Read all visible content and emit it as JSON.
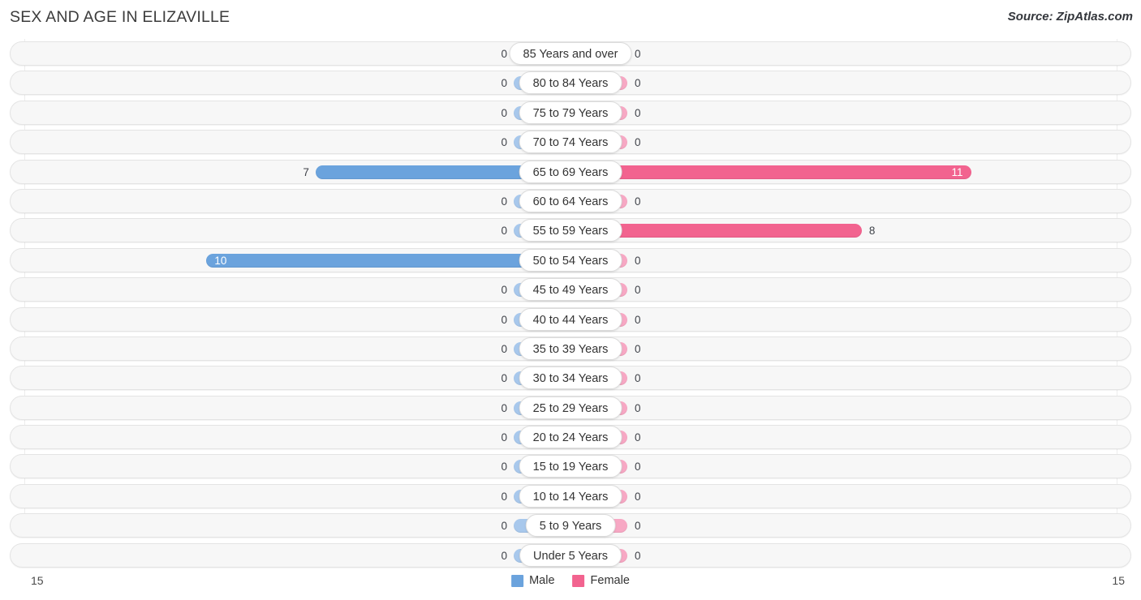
{
  "header": {
    "title": "SEX AND AGE IN ELIZAVILLE",
    "source": "Source: ZipAtlas.com"
  },
  "legend": {
    "male_label": "Male",
    "female_label": "Female",
    "male_color": "#6ba3dd",
    "female_color": "#f2638f"
  },
  "axis": {
    "left_max": "15",
    "right_max": "15"
  },
  "colors": {
    "male_active": "#6ba3dd",
    "male_zero": "#a8c8ec",
    "female_active": "#f2638f",
    "female_zero": "#f7a8c4",
    "track": "#f7f7f7",
    "track_border": "#e4e4e4"
  },
  "chart_data": {
    "type": "bar",
    "subtype": "population-pyramid",
    "title": "SEX AND AGE IN ELIZAVILLE",
    "source": "Source: ZipAtlas.com",
    "xlabel": "",
    "ylabel": "",
    "xlim": [
      15,
      15
    ],
    "grid": true,
    "legend_position": "bottom-center",
    "categories": [
      "85 Years and over",
      "80 to 84 Years",
      "75 to 79 Years",
      "70 to 74 Years",
      "65 to 69 Years",
      "60 to 64 Years",
      "55 to 59 Years",
      "50 to 54 Years",
      "45 to 49 Years",
      "40 to 44 Years",
      "35 to 39 Years",
      "30 to 34 Years",
      "25 to 29 Years",
      "20 to 24 Years",
      "15 to 19 Years",
      "10 to 14 Years",
      "5 to 9 Years",
      "Under 5 Years"
    ],
    "series": [
      {
        "name": "Male",
        "values": [
          0,
          0,
          0,
          0,
          7,
          0,
          0,
          10,
          0,
          0,
          0,
          0,
          0,
          0,
          0,
          0,
          0,
          0
        ]
      },
      {
        "name": "Female",
        "values": [
          0,
          0,
          0,
          0,
          11,
          0,
          8,
          0,
          0,
          0,
          0,
          0,
          0,
          0,
          0,
          0,
          0,
          0
        ]
      }
    ]
  },
  "rows": [
    {
      "age": "85 Years and over",
      "male": "0",
      "female": "0"
    },
    {
      "age": "80 to 84 Years",
      "male": "0",
      "female": "0"
    },
    {
      "age": "75 to 79 Years",
      "male": "0",
      "female": "0"
    },
    {
      "age": "70 to 74 Years",
      "male": "0",
      "female": "0"
    },
    {
      "age": "65 to 69 Years",
      "male": "7",
      "female": "11"
    },
    {
      "age": "60 to 64 Years",
      "male": "0",
      "female": "0"
    },
    {
      "age": "55 to 59 Years",
      "male": "0",
      "female": "8"
    },
    {
      "age": "50 to 54 Years",
      "male": "10",
      "female": "0"
    },
    {
      "age": "45 to 49 Years",
      "male": "0",
      "female": "0"
    },
    {
      "age": "40 to 44 Years",
      "male": "0",
      "female": "0"
    },
    {
      "age": "35 to 39 Years",
      "male": "0",
      "female": "0"
    },
    {
      "age": "30 to 34 Years",
      "male": "0",
      "female": "0"
    },
    {
      "age": "25 to 29 Years",
      "male": "0",
      "female": "0"
    },
    {
      "age": "20 to 24 Years",
      "male": "0",
      "female": "0"
    },
    {
      "age": "15 to 19 Years",
      "male": "0",
      "female": "0"
    },
    {
      "age": "10 to 14 Years",
      "male": "0",
      "female": "0"
    },
    {
      "age": "5 to 9 Years",
      "male": "0",
      "female": "0"
    },
    {
      "age": "Under 5 Years",
      "male": "0",
      "female": "0"
    }
  ]
}
